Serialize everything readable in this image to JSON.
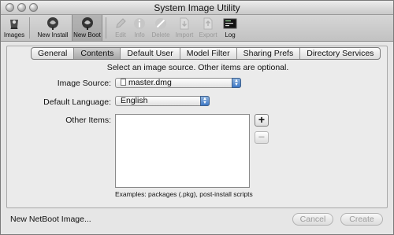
{
  "window": {
    "title": "System Image Utility"
  },
  "toolbar": {
    "items": [
      {
        "label": "Images",
        "icon": "images-icon",
        "enabled": true
      },
      {
        "label": "New Install",
        "icon": "new-install-icon",
        "enabled": true
      },
      {
        "label": "New Boot",
        "icon": "new-boot-icon",
        "enabled": true,
        "selected": true
      },
      {
        "label": "Edit",
        "icon": "pencil-icon",
        "enabled": false
      },
      {
        "label": "Info",
        "icon": "info-icon",
        "enabled": false
      },
      {
        "label": "Delete",
        "icon": "delete-icon",
        "enabled": false
      },
      {
        "label": "Import",
        "icon": "import-icon",
        "enabled": false
      },
      {
        "label": "Export",
        "icon": "export-icon",
        "enabled": false
      },
      {
        "label": "Log",
        "icon": "log-icon",
        "enabled": true
      }
    ]
  },
  "tabs": [
    {
      "label": "General",
      "active": false
    },
    {
      "label": "Contents",
      "active": true
    },
    {
      "label": "Default User",
      "active": false
    },
    {
      "label": "Model Filter",
      "active": false
    },
    {
      "label": "Sharing Prefs",
      "active": false
    },
    {
      "label": "Directory Services",
      "active": false
    }
  ],
  "contents": {
    "instruction": "Select an image source. Other items are optional.",
    "image_source_label": "Image Source:",
    "image_source_value": "master.dmg",
    "default_language_label": "Default Language:",
    "default_language_value": "English",
    "other_items_label": "Other Items:",
    "add_label": "+",
    "remove_label": "−",
    "examples": "Examples: packages (.pkg), post-install scripts"
  },
  "footer": {
    "label": "New NetBoot Image...",
    "cancel_label": "Cancel",
    "create_label": "Create"
  },
  "colors": {
    "popup_arrow_blue": "#3d78c6",
    "window_bg": "#e6e6e6"
  }
}
